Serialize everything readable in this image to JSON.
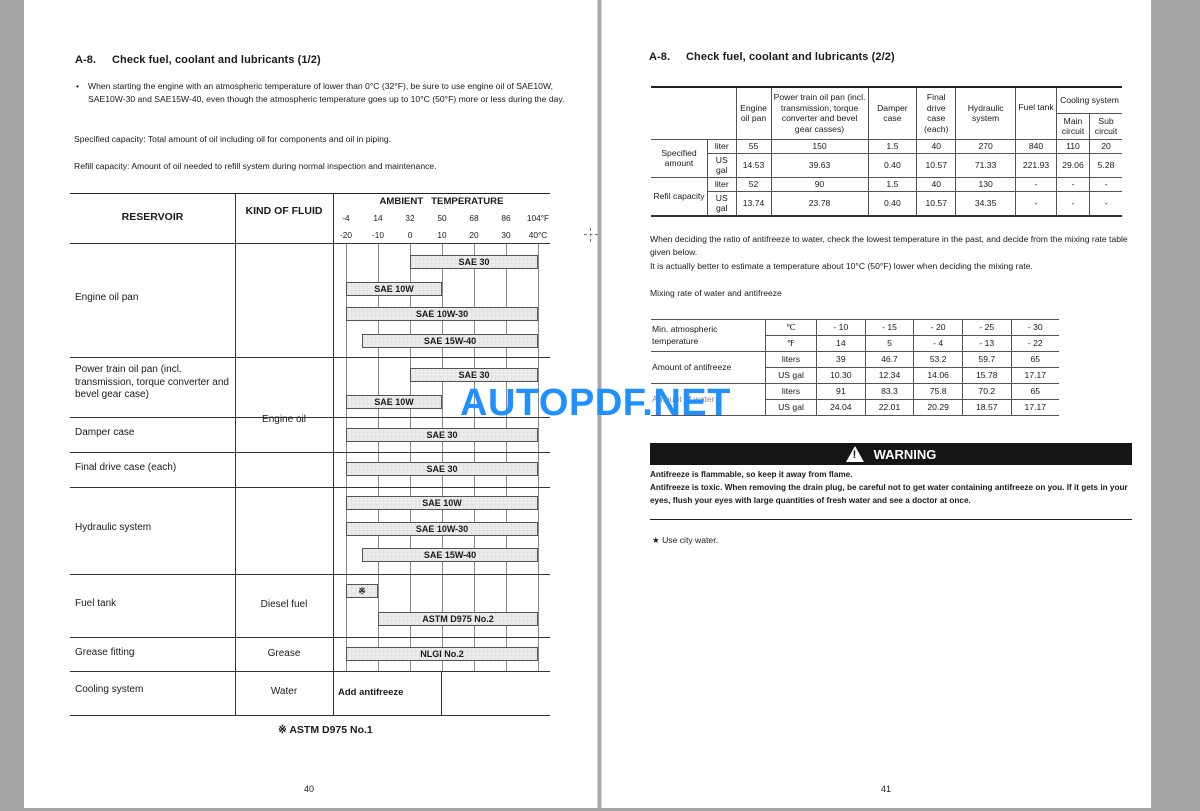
{
  "left_page": {
    "section_number": "A-8.",
    "title": "Check fuel, coolant and lubricants (1/2)",
    "bullet": "When starting the engine with an atmospheric temperature of lower than 0°C (32°F), be sure to use engine oil of SAE10W, SAE10W-30 and SAE15W-40, even though the atmospheric temperature goes up to 10°C (50°F) more or less during the day.",
    "specified_capacity": "Specified capacity: Total amount of oil including oil for components and oil in piping.",
    "refill_capacity": "Refill capacity: Amount of oil needed to refill system during normal inspection and maintenance.",
    "table": {
      "header_reservoir": "RESERVOIR",
      "header_fluid": "KIND OF FLUID",
      "header_ambient": "AMBIENT   TEMPERATURE",
      "ticks_f": [
        "-4",
        "14",
        "32",
        "50",
        "68",
        "86",
        "104°F"
      ],
      "ticks_c": [
        "-20",
        "-10",
        "0",
        "10",
        "20",
        "30",
        "40°C"
      ],
      "rows": [
        {
          "reservoir": "Engine oil pan",
          "bars": [
            {
              "label": "SAE 30",
              "from_c": 0,
              "to_c": 40
            },
            {
              "label": "SAE 10W",
              "from_c": -20,
              "to_c": 10
            },
            {
              "label": "SAE 10W-30",
              "from_c": -20,
              "to_c": 40
            },
            {
              "label": "SAE 15W-40",
              "from_c": -15,
              "to_c": 40
            }
          ]
        },
        {
          "reservoir": "Power train oil pan (incl. transmission, torque converter and bevel gear case)",
          "bars": [
            {
              "label": "SAE 30",
              "from_c": 0,
              "to_c": 40
            },
            {
              "label": "SAE 10W",
              "from_c": -20,
              "to_c": 10
            }
          ]
        },
        {
          "reservoir": "Damper case",
          "bars": [
            {
              "label": "SAE 30",
              "from_c": -20,
              "to_c": 40
            }
          ]
        },
        {
          "reservoir": "Final drive case (each)",
          "bars": [
            {
              "label": "SAE 30",
              "from_c": -20,
              "to_c": 40
            }
          ]
        },
        {
          "reservoir": "Hydraulic system",
          "bars": [
            {
              "label": "SAE 10W",
              "from_c": -20,
              "to_c": 40
            },
            {
              "label": "SAE 10W-30",
              "from_c": -20,
              "to_c": 40
            },
            {
              "label": "SAE 15W-40",
              "from_c": -15,
              "to_c": 40
            }
          ]
        },
        {
          "reservoir": "Fuel tank",
          "bars": [
            {
              "label": "※",
              "from_c": -20,
              "to_c": -10
            },
            {
              "label": "ASTM D975 No.2",
              "from_c": -10,
              "to_c": 40
            }
          ]
        },
        {
          "reservoir": "Grease fitting",
          "bars": [
            {
              "label": "NLGI No.2",
              "from_c": -20,
              "to_c": 40
            }
          ]
        },
        {
          "reservoir": "Cooling system",
          "bars": []
        }
      ],
      "fluids": {
        "engine_oil": "Engine oil",
        "diesel": "Diesel fuel",
        "grease": "Grease",
        "water": "Water",
        "add_antifreeze": "Add antifreeze"
      },
      "footnote": "※ ASTM D975 No.1"
    },
    "page_number": "40"
  },
  "right_page": {
    "section_number": "A-8.",
    "title": "Check fuel, coolant and lubricants (2/2)",
    "capacity_table": {
      "columns": [
        "Engine oil pan",
        "Power train oil pan (incl. transmission, torque converter and bevel gear casses)",
        "Damper case",
        "Final drive case (each)",
        "Hydraulic system",
        "Fuel tank"
      ],
      "cooling_header": "Cooling system",
      "cooling_sub": [
        "Main circuit",
        "Sub circuit"
      ],
      "rows": [
        {
          "group": "Specified amount",
          "unit": "liter",
          "values": [
            "55",
            "150",
            "1.5",
            "40",
            "270",
            "840",
            "110",
            "20"
          ]
        },
        {
          "group": "Specified amount",
          "unit": "US gal",
          "values": [
            "14.53",
            "39.63",
            "0.40",
            "10.57",
            "71.33",
            "221.93",
            "29.06",
            "5.28"
          ]
        },
        {
          "group": "Refil capacity",
          "unit": "liter",
          "values": [
            "52",
            "90",
            "1.5",
            "40",
            "130",
            "-",
            "-",
            "-"
          ]
        },
        {
          "group": "Refil capacity",
          "unit": "US gal",
          "values": [
            "13.74",
            "23.78",
            "0.40",
            "10.57",
            "34.35",
            "-",
            "-",
            "-"
          ]
        }
      ],
      "groups": [
        "Specified amount",
        "Refil capacity"
      ]
    },
    "paragraph_1": "When deciding the ratio of antifreeze to water, check the lowest temperature in the past, and decide from the mixing rate table given below.",
    "paragraph_2": "It is actually better to estimate a temperature about 10°C (50°F) lower when deciding the mixing rate.",
    "mix_title": "Mixing rate of water and antifreeze",
    "mix_table": {
      "row_groups": [
        "Min. atmospheric temperature",
        "Amount of antifreeze",
        "Amount of water"
      ],
      "rows": [
        {
          "unit": "℃",
          "values": [
            "- 10",
            "- 15",
            "- 20",
            "- 25",
            "- 30"
          ]
        },
        {
          "unit": "℉",
          "values": [
            "14",
            "5",
            "- 4",
            "- 13",
            "- 22"
          ]
        },
        {
          "unit": "liters",
          "values": [
            "39",
            "46.7",
            "53.2",
            "59.7",
            "65"
          ]
        },
        {
          "unit": "US gal",
          "values": [
            "10.30",
            "12.34",
            "14.06",
            "15.78",
            "17.17"
          ]
        },
        {
          "unit": "liters",
          "values": [
            "91",
            "83.3",
            "75.8",
            "70.2",
            "65"
          ]
        },
        {
          "unit": "US gal",
          "values": [
            "24.04",
            "22.01",
            "20.29",
            "18.57",
            "17.17"
          ]
        }
      ]
    },
    "warning": {
      "label": "WARNING",
      "line_1": "Antifreeze is flammable, so keep it away from flame.",
      "line_2": "Antifreeze is toxic.  When removing the drain plug, be careful not to get water containing antifreeze on you.  If it gets in your eyes, flush your eyes with large quantities of fresh water and see a doctor at once."
    },
    "note": "★ Use city water.",
    "page_number": "41"
  },
  "watermark": "AUTOPDF.NET",
  "colors": {
    "watermark": "#1e90ff",
    "warning_bar": "#151515",
    "background": "#a7a7a7"
  }
}
